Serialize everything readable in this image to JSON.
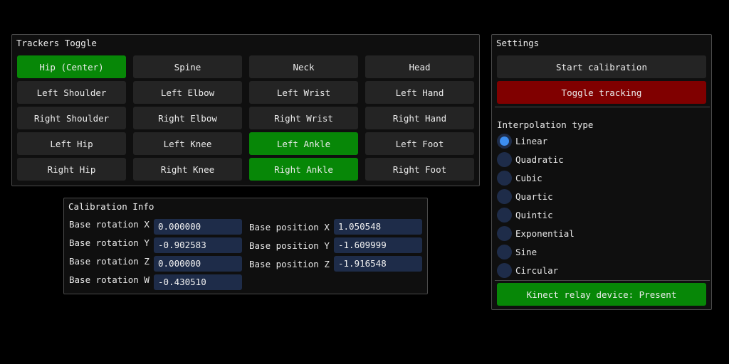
{
  "trackers": {
    "title": "Trackers Toggle",
    "buttons": [
      {
        "label": "Hip (Center)",
        "active": true
      },
      {
        "label": "Spine",
        "active": false
      },
      {
        "label": "Neck",
        "active": false
      },
      {
        "label": "Head",
        "active": false
      },
      {
        "label": "Left Shoulder",
        "active": false
      },
      {
        "label": "Left Elbow",
        "active": false
      },
      {
        "label": "Left Wrist",
        "active": false
      },
      {
        "label": "Left Hand",
        "active": false
      },
      {
        "label": "Right Shoulder",
        "active": false
      },
      {
        "label": "Right Elbow",
        "active": false
      },
      {
        "label": "Right Wrist",
        "active": false
      },
      {
        "label": "Right Hand",
        "active": false
      },
      {
        "label": "Left Hip",
        "active": false
      },
      {
        "label": "Left Knee",
        "active": false
      },
      {
        "label": "Left Ankle",
        "active": true
      },
      {
        "label": "Left Foot",
        "active": false
      },
      {
        "label": "Right Hip",
        "active": false
      },
      {
        "label": "Right Knee",
        "active": false
      },
      {
        "label": "Right Ankle",
        "active": true
      },
      {
        "label": "Right Foot",
        "active": false
      }
    ]
  },
  "calibration": {
    "title": "Calibration Info",
    "rotation": [
      {
        "label": "Base rotation X",
        "value": "0.000000"
      },
      {
        "label": "Base rotation Y",
        "value": "-0.902583"
      },
      {
        "label": "Base rotation Z",
        "value": "0.000000"
      },
      {
        "label": "Base rotation W",
        "value": "-0.430510"
      }
    ],
    "position": [
      {
        "label": "Base position X",
        "value": "1.050548"
      },
      {
        "label": "Base position Y",
        "value": "-1.609999"
      },
      {
        "label": "Base position Z",
        "value": "-1.916548"
      }
    ]
  },
  "settings": {
    "title": "Settings",
    "start_calibration": "Start calibration",
    "toggle_tracking": "Toggle tracking",
    "interpolation_label": "Interpolation type",
    "interpolation_options": [
      "Linear",
      "Quadratic",
      "Cubic",
      "Quartic",
      "Quintic",
      "Exponential",
      "Sine",
      "Circular"
    ],
    "interpolation_selected": "Linear",
    "device_status": "Kinect relay device: Present"
  },
  "colors": {
    "active_green": "#078707",
    "danger_red": "#800000",
    "field_blue": "#1e2c49",
    "radio_selected": "#3d8ef0"
  }
}
